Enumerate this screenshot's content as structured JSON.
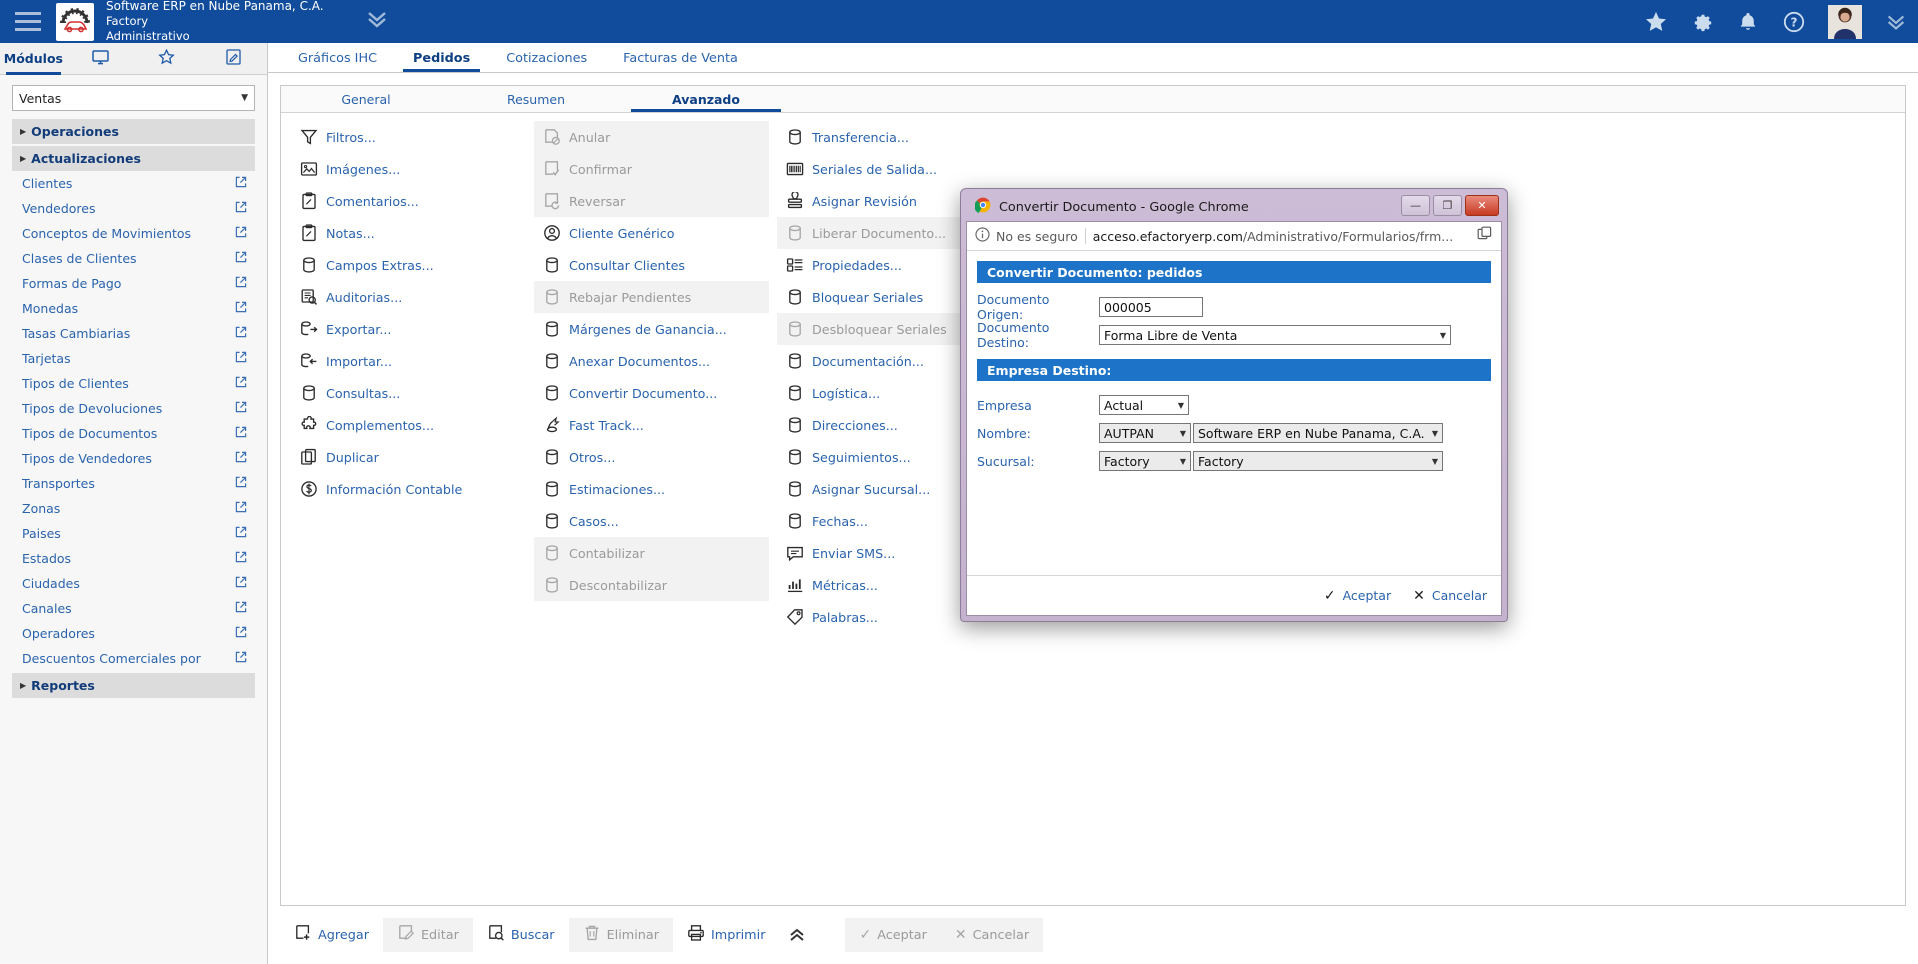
{
  "topbar": {
    "brand_line1": "Software ERP en Nube Panama, C.A.",
    "brand_line2": "Factory",
    "brand_line3": "Administrativo",
    "menu_icon": "hamburger-icon",
    "logo_icon": "company-logo-icon",
    "chevron_icon": "chevron-double-down-icon",
    "icons": [
      "star-icon",
      "gear-icon",
      "bell-icon",
      "help-icon"
    ],
    "avatar": "user-avatar",
    "right_chevron_icon": "chevron-double-down-icon",
    "accent": "#114c9c"
  },
  "sidebar": {
    "tabs": [
      {
        "label": "Módulos",
        "icon": "modules-tab",
        "active": true
      },
      {
        "label": "",
        "icon": "monitor-icon",
        "active": false
      },
      {
        "label": "",
        "icon": "star-outline-icon",
        "active": false
      },
      {
        "label": "",
        "icon": "note-edit-icon",
        "active": false
      }
    ],
    "module_select": "Ventas",
    "groups": [
      {
        "label": "Operaciones",
        "expanded": false
      },
      {
        "label": "Actualizaciones",
        "expanded": true
      }
    ],
    "items": [
      {
        "label": "Clientes",
        "ext": true
      },
      {
        "label": "Vendedores",
        "ext": true
      },
      {
        "label": "Conceptos de Movimientos",
        "ext": true
      },
      {
        "label": "Clases de Clientes",
        "ext": true
      },
      {
        "label": "Formas de Pago",
        "ext": true
      },
      {
        "label": "Monedas",
        "ext": true
      },
      {
        "label": "Tasas Cambiarias",
        "ext": true
      },
      {
        "label": "Tarjetas",
        "ext": true
      },
      {
        "label": "Tipos de Clientes",
        "ext": true
      },
      {
        "label": "Tipos de Devoluciones",
        "ext": true
      },
      {
        "label": "Tipos de Documentos",
        "ext": true
      },
      {
        "label": "Tipos de Vendedores",
        "ext": true
      },
      {
        "label": "Transportes",
        "ext": true
      },
      {
        "label": "Zonas",
        "ext": true
      },
      {
        "label": "Paises",
        "ext": true
      },
      {
        "label": "Estados",
        "ext": true
      },
      {
        "label": "Ciudades",
        "ext": true
      },
      {
        "label": "Canales",
        "ext": true
      },
      {
        "label": "Operadores",
        "ext": true
      },
      {
        "label": "Descuentos Comerciales por",
        "ext": true
      }
    ],
    "footer_group": {
      "label": "Reportes",
      "expanded": false
    }
  },
  "main": {
    "tabs": [
      {
        "label": "Gráficos IHC",
        "active": false
      },
      {
        "label": "Pedidos",
        "active": true
      },
      {
        "label": "Cotizaciones",
        "active": false
      },
      {
        "label": "Facturas de Venta",
        "active": false
      }
    ],
    "subtabs": [
      {
        "label": "General",
        "active": false
      },
      {
        "label": "Resumen",
        "active": false
      },
      {
        "label": "Avanzado",
        "active": true
      }
    ],
    "columns": [
      [
        {
          "label": "Filtros...",
          "icon": "funnel-icon",
          "disabled": false
        },
        {
          "label": "Imágenes...",
          "icon": "image-icon",
          "disabled": false
        },
        {
          "label": "Comentarios...",
          "icon": "clipboard-pencil-icon",
          "disabled": false
        },
        {
          "label": "Notas...",
          "icon": "clipboard-pencil-icon",
          "disabled": false
        },
        {
          "label": "Campos Extras...",
          "icon": "database-icon",
          "disabled": false
        },
        {
          "label": "Auditorias...",
          "icon": "audit-search-icon",
          "disabled": false
        },
        {
          "label": "Exportar...",
          "icon": "export-icon",
          "disabled": false
        },
        {
          "label": "Importar...",
          "icon": "import-icon",
          "disabled": false
        },
        {
          "label": "Consultas...",
          "icon": "database-icon",
          "disabled": false
        },
        {
          "label": "Complementos...",
          "icon": "puzzle-icon",
          "disabled": false
        },
        {
          "label": "Duplicar",
          "icon": "copy-icon",
          "disabled": false
        },
        {
          "label": "Información Contable",
          "icon": "dollar-circle-icon",
          "disabled": false
        }
      ],
      [
        {
          "label": "Anular",
          "icon": "cancel-doc-icon",
          "disabled": true
        },
        {
          "label": "Confirmar",
          "icon": "check-doc-icon",
          "disabled": true
        },
        {
          "label": "Reversar",
          "icon": "revert-doc-icon",
          "disabled": true
        },
        {
          "label": "Cliente Genérico",
          "icon": "user-circle-icon",
          "disabled": false
        },
        {
          "label": "Consultar Clientes",
          "icon": "database-icon",
          "disabled": false
        },
        {
          "label": "Rebajar Pendientes",
          "icon": "database-icon",
          "disabled": true
        },
        {
          "label": "Márgenes de Ganancia...",
          "icon": "database-icon",
          "disabled": false
        },
        {
          "label": "Anexar Documentos...",
          "icon": "database-icon",
          "disabled": false
        },
        {
          "label": "Convertir Documento...",
          "icon": "database-icon",
          "disabled": false
        },
        {
          "label": "Fast Track...",
          "icon": "fast-track-icon",
          "disabled": false
        },
        {
          "label": "Otros...",
          "icon": "database-icon",
          "disabled": false
        },
        {
          "label": "Estimaciones...",
          "icon": "database-icon",
          "disabled": false
        },
        {
          "label": "Casos...",
          "icon": "database-icon",
          "disabled": false
        },
        {
          "label": "Contabilizar",
          "icon": "database-icon",
          "disabled": true
        },
        {
          "label": "Descontabilizar",
          "icon": "database-icon",
          "disabled": true
        }
      ],
      [
        {
          "label": "Transferencia...",
          "icon": "database-icon",
          "disabled": false
        },
        {
          "label": "Seriales de Salida...",
          "icon": "barcode-icon",
          "disabled": false
        },
        {
          "label": "Asignar Revisión",
          "icon": "stamp-icon",
          "disabled": false
        },
        {
          "label": "Liberar Documento...",
          "icon": "database-icon",
          "disabled": true
        },
        {
          "label": "Propiedades...",
          "icon": "grid-properties-icon",
          "disabled": false
        },
        {
          "label": "Bloquear Seriales",
          "icon": "database-icon",
          "disabled": false
        },
        {
          "label": "Desbloquear Seriales",
          "icon": "database-icon",
          "disabled": true
        },
        {
          "label": "Documentación...",
          "icon": "database-icon",
          "disabled": false
        },
        {
          "label": "Logística...",
          "icon": "database-icon",
          "disabled": false
        },
        {
          "label": "Direcciones...",
          "icon": "database-icon",
          "disabled": false
        },
        {
          "label": "Seguimientos...",
          "icon": "database-icon",
          "disabled": false
        },
        {
          "label": "Asignar Sucursal...",
          "icon": "database-icon",
          "disabled": false
        },
        {
          "label": "Fechas...",
          "icon": "database-icon",
          "disabled": false
        },
        {
          "label": "Enviar SMS...",
          "icon": "sms-icon",
          "disabled": false
        },
        {
          "label": "Métricas...",
          "icon": "metrics-icon",
          "disabled": false
        },
        {
          "label": "Palabras...",
          "icon": "tag-icon",
          "disabled": false
        }
      ]
    ]
  },
  "bottombar": [
    {
      "label": "Agregar",
      "icon": "add-doc-icon",
      "disabled": false
    },
    {
      "label": "Editar",
      "icon": "edit-doc-icon",
      "disabled": true
    },
    {
      "label": "Buscar",
      "icon": "search-doc-icon",
      "disabled": false
    },
    {
      "label": "Eliminar",
      "icon": "trash-icon",
      "disabled": true
    },
    {
      "label": "Imprimir",
      "icon": "printer-icon",
      "disabled": false
    }
  ],
  "bottombar_right": [
    {
      "label": "Aceptar",
      "icon": "check-icon",
      "disabled": true
    },
    {
      "label": "Cancelar",
      "icon": "x-icon",
      "disabled": true
    }
  ],
  "bottombar_collapse_icon": "chevron-double-up-icon",
  "popup": {
    "window_title": "Convertir Documento - Google Chrome",
    "favicon": "chrome-icon",
    "window_buttons": [
      {
        "name": "minimize-button",
        "glyph": "—"
      },
      {
        "name": "maximize-button",
        "glyph": "❐"
      },
      {
        "name": "close-button",
        "glyph": "✕"
      }
    ],
    "url": {
      "security_label": "No es seguro",
      "security_icon": "info-circle-icon",
      "host": "acceso.efactoryerp.com",
      "path": "/Administrativo/Formularios/frm...",
      "copy_icon": "copy-url-icon"
    },
    "section1_title": "Convertir Documento: pedidos",
    "fields": [
      {
        "label": "Documento Origen:",
        "type": "text",
        "value": "000005"
      },
      {
        "label": "Documento Destino:",
        "type": "select",
        "value": "Forma Libre de Venta"
      }
    ],
    "section2_title": "Empresa Destino:",
    "fields2": [
      {
        "label": "Empresa",
        "type": "select",
        "value": "Actual"
      },
      {
        "label": "Nombre:",
        "type": "select2",
        "value": "AUTPAN",
        "value2": "Software ERP en Nube Panama, C.A."
      },
      {
        "label": "Sucursal:",
        "type": "select2",
        "value": "Factory",
        "value2": "Factory"
      }
    ],
    "footer": [
      {
        "label": "Aceptar",
        "icon": "check-icon"
      },
      {
        "label": "Cancelar",
        "icon": "x-icon"
      }
    ]
  }
}
